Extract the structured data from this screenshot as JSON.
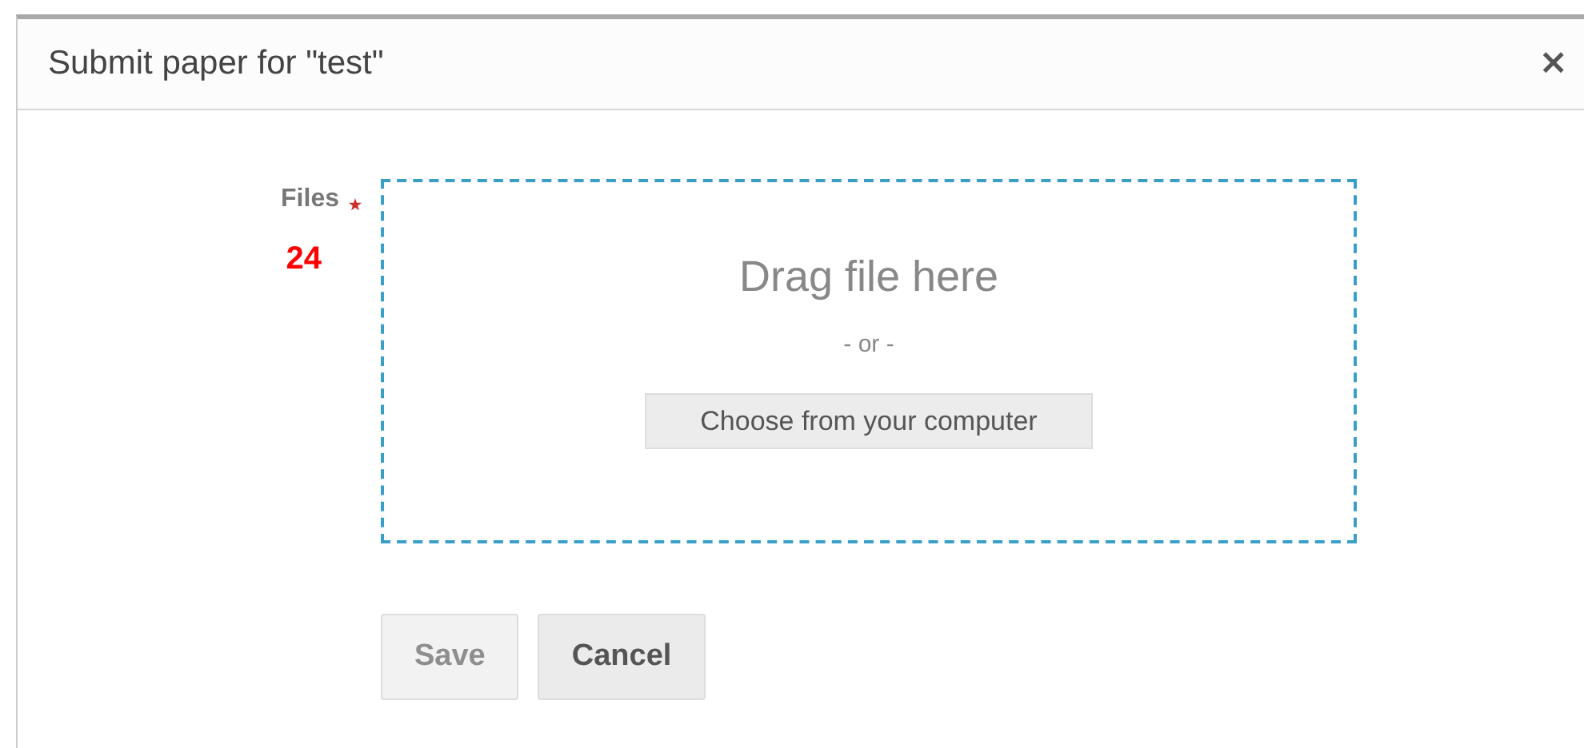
{
  "dialog": {
    "title": "Submit paper for \"test\"",
    "close": "×"
  },
  "form": {
    "field_label": "Files",
    "required": true,
    "annotation": "24",
    "dropzone": {
      "prompt": "Drag file here",
      "separator": "- or -",
      "button": "Choose from your computer"
    }
  },
  "buttons": [
    {
      "label": "Save",
      "disabled": true
    },
    {
      "label": "Cancel",
      "disabled": false
    }
  ]
}
